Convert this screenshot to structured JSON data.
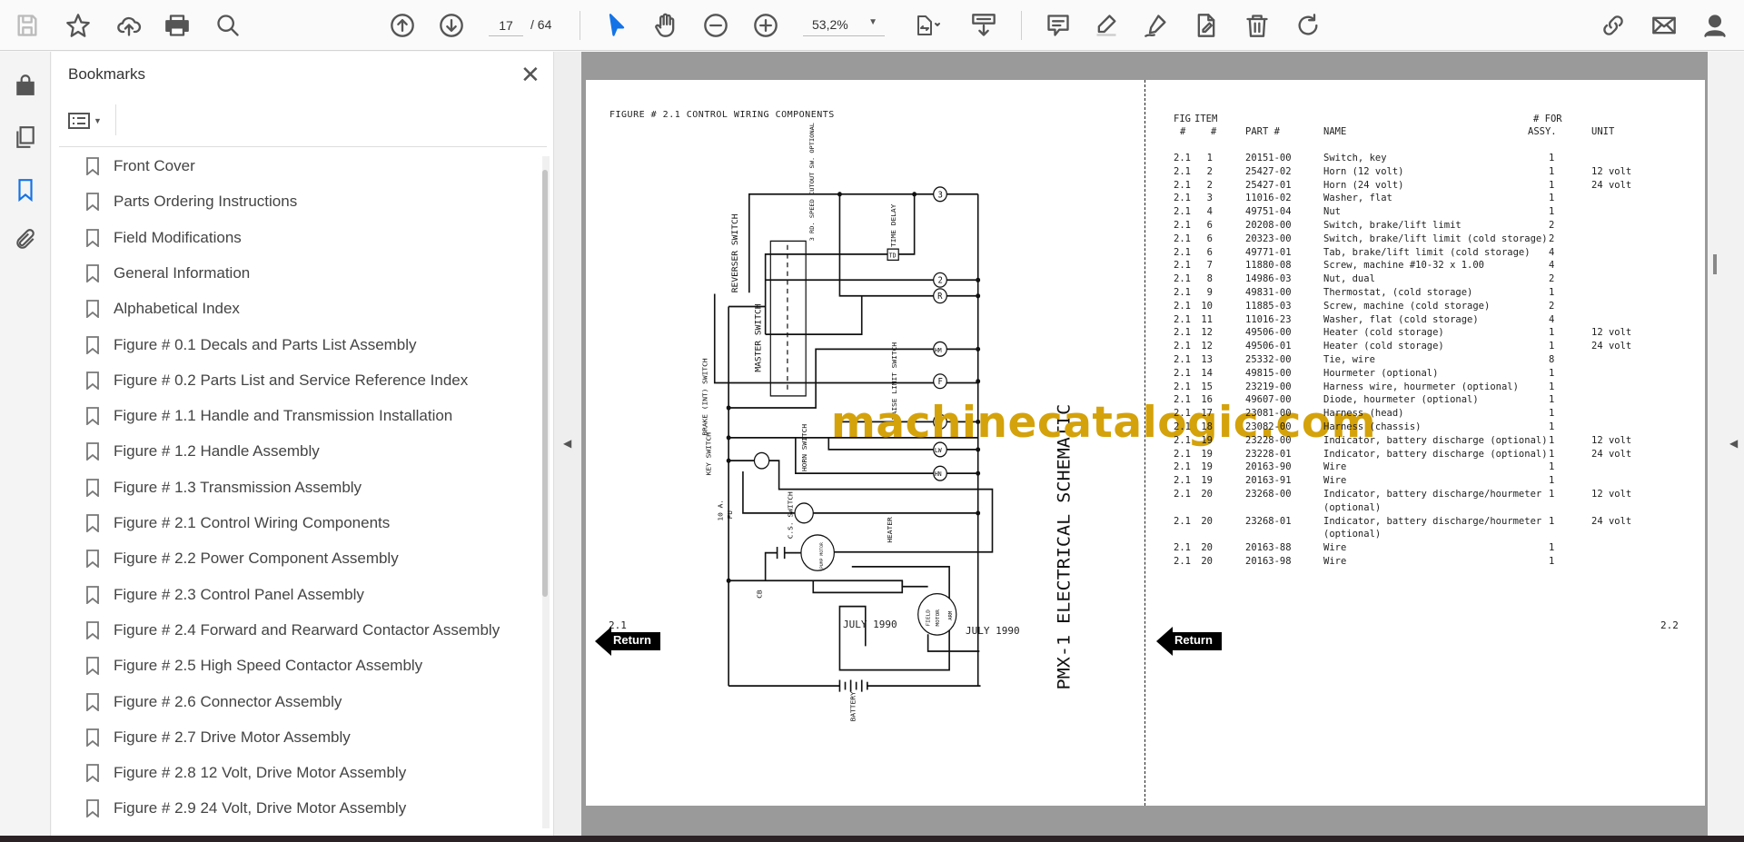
{
  "toolbar": {
    "page_current": "17",
    "page_total": "/ 64",
    "zoom": "53,2%"
  },
  "panel": {
    "title": "Bookmarks",
    "bookmarks": [
      "Front Cover",
      "Parts Ordering Instructions",
      "Field Modifications",
      "General Information",
      "Alphabetical Index",
      "Figure # 0.1 Decals and Parts List Assembly",
      "Figure # 0.2 Parts List and Service Reference Index",
      "Figure # 1.1 Handle and Transmission Installation",
      "Figure # 1.2 Handle Assembly",
      "Figure # 1.3 Transmission Assembly",
      "Figure # 2.1 Control Wiring Components",
      "Figure # 2.2 Power Component Assembly",
      "Figure # 2.3 Control Panel Assembly",
      "Figure # 2.4 Forward and Rearward Contactor Assembly",
      "Figure # 2.5 High Speed Contactor Assembly",
      "Figure # 2.6 Connector Assembly",
      "Figure # 2.7 Drive Motor Assembly",
      "Figure # 2.8 12 Volt, Drive Motor Assembly",
      "Figure # 2.9 24 Volt, Drive Motor Assembly"
    ]
  },
  "document": {
    "left_page": {
      "figure_title": "FIGURE # 2.1 CONTROL WIRING COMPONENTS",
      "schematic_title": "PMX-1 ELECTRICAL SCHEMATIC",
      "page_number": "2.1",
      "date": "JULY 1990",
      "return_label": "Return",
      "schematic_labels": {
        "reverser": "REVERSER SWITCH",
        "master": "MASTER SWITCH",
        "time_delay": "TIME DELAY",
        "td": "TD",
        "cutout": "3 RD. SPEED CUTOUT SW. OPTIONAL",
        "brake": "BRAKE (INT) SWITCH",
        "key": "KEY SWITCH",
        "horn": "HORN SWITCH",
        "raise": "RAISE LIMIT SWITCH",
        "heater": "HEATER",
        "cs": "C.S. SWITCH",
        "fuse": "10 A.",
        "fu": "FU",
        "cb": "CB",
        "battery": "BATTERY",
        "field": "FIELD",
        "motor": "MOTOR",
        "arm": "ARM",
        "pump": "PUMP MOTOR",
        "nodes": [
          "3",
          "2",
          "R",
          "HM",
          "F",
          "LR",
          "LW",
          "HN"
        ]
      }
    },
    "right_page": {
      "headers": {
        "fig_1": "FIG",
        "fig_2": "#",
        "item_1": "ITEM",
        "item_2": "#",
        "part": "PART #",
        "name": "NAME",
        "qty_1": "# FOR",
        "qty_2": "ASSY.",
        "unit": "UNIT"
      },
      "rows": [
        [
          "2.1",
          "1",
          "20151-00",
          "Switch, key",
          "1",
          ""
        ],
        [
          "2.1",
          "2",
          "25427-02",
          "Horn (12 volt)",
          "1",
          "12 volt"
        ],
        [
          "2.1",
          "2",
          "25427-01",
          "Horn (24 volt)",
          "1",
          "24 volt"
        ],
        [
          "2.1",
          "3",
          "11016-02",
          "Washer, flat",
          "1",
          ""
        ],
        [
          "2.1",
          "4",
          "49751-04",
          "Nut",
          "1",
          ""
        ],
        [
          "2.1",
          "6",
          "20208-00",
          "Switch, brake/lift limit",
          "2",
          ""
        ],
        [
          "2.1",
          "6",
          "20323-00",
          "Switch, brake/lift limit (cold storage)",
          "2",
          ""
        ],
        [
          "2.1",
          "6",
          "49771-01",
          "Tab, brake/lift limit (cold storage)",
          "4",
          ""
        ],
        [
          "2.1",
          "7",
          "11880-08",
          "Screw, machine #10-32 x 1.00",
          "4",
          ""
        ],
        [
          "2.1",
          "8",
          "14986-03",
          "Nut, dual",
          "2",
          ""
        ],
        [
          "2.1",
          "9",
          "49831-00",
          "Thermostat, (cold storage)",
          "1",
          ""
        ],
        [
          "2.1",
          "10",
          "11885-03",
          "Screw, machine (cold storage)",
          "2",
          ""
        ],
        [
          "2.1",
          "11",
          "11016-23",
          "Washer, flat (cold storage)",
          "4",
          ""
        ],
        [
          "2.1",
          "12",
          "49506-00",
          "Heater (cold storage)",
          "1",
          "12 volt"
        ],
        [
          "2.1",
          "12",
          "49506-01",
          "Heater (cold storage)",
          "1",
          "24 volt"
        ],
        [
          "2.1",
          "13",
          "25332-00",
          "Tie, wire",
          "8",
          ""
        ],
        [
          "2.1",
          "14",
          "49815-00",
          "Hourmeter (optional)",
          "1",
          ""
        ],
        [
          "2.1",
          "15",
          "23219-00",
          "Harness wire, hourmeter (optional)",
          "1",
          ""
        ],
        [
          "2.1",
          "16",
          "49607-00",
          "Diode, hourmeter (optional)",
          "1",
          ""
        ],
        [
          "2.1",
          "17",
          "23081-00",
          "Harness (head)",
          "1",
          ""
        ],
        [
          "2.1",
          "18",
          "23082-00",
          "Harness (chassis)",
          "1",
          ""
        ],
        [
          "2.1",
          "19",
          "23228-00",
          "Indicator, battery discharge (optional)",
          "1",
          "12 volt"
        ],
        [
          "2.1",
          "19",
          "23228-01",
          "Indicator, battery discharge (optional)",
          "1",
          "24 volt"
        ],
        [
          "2.1",
          "19",
          "20163-90",
          "Wire",
          "1",
          ""
        ],
        [
          "2.1",
          "19",
          "20163-91",
          "Wire",
          "1",
          ""
        ],
        [
          "2.1",
          "20",
          "23268-00",
          "Indicator, battery discharge/hourmeter\n(optional)",
          "1",
          "12 volt"
        ],
        [
          "2.1",
          "20",
          "23268-01",
          "Indicator, battery discharge/hourmeter\n(optional)",
          "1",
          "24 volt"
        ],
        [
          "2.1",
          "20",
          "20163-88",
          "Wire",
          "1",
          ""
        ],
        [
          "2.1",
          "20",
          "20163-98",
          "Wire",
          "1",
          ""
        ]
      ],
      "date": "JULY 1990",
      "page_number": "2.2",
      "return_label": "Return"
    },
    "watermark": "machinecatalogic.com"
  },
  "colors": {
    "accent": "#1473e6",
    "watermark": "#d4a20a",
    "doc_bg": "#9a9a9a"
  }
}
